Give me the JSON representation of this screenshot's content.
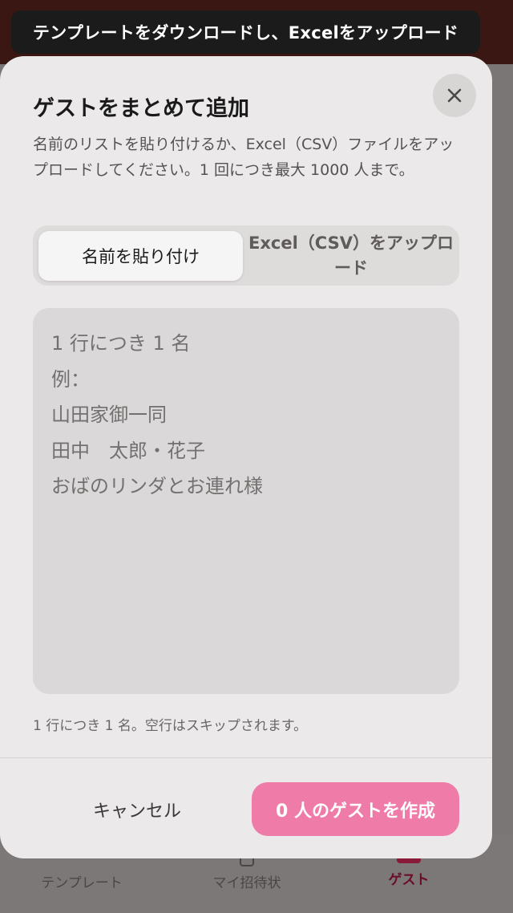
{
  "toast": {
    "text": "テンプレートをダウンロードし、Excelをアップロード"
  },
  "modal": {
    "title": "ゲストをまとめて追加",
    "description": "名前のリストを貼り付けるか、Excel（CSV）ファイルをアップロードしてください。1 回につき最大 1000 人まで。",
    "close_icon": "close-icon",
    "segments": [
      {
        "label": "名前を貼り付け",
        "selected": true
      },
      {
        "label": "Excel（CSV）をアップロード",
        "selected": false
      }
    ],
    "textarea": {
      "value": "",
      "placeholder": "1 行につき 1 名\n例：\n山田家御一同\n田中　太郎・花子\nおばのリンダとお連れ様"
    },
    "hint": "1 行につき 1 名。空行はスキップされます。",
    "cancel_label": "キャンセル",
    "create_label": "0 人のゲストを作成"
  },
  "tabbar": {
    "items": [
      {
        "label": "テンプレート",
        "icon": "grid-icon",
        "active": false
      },
      {
        "label": "マイ招待状",
        "icon": "invitation-icon",
        "active": false
      },
      {
        "label": "ゲスト",
        "icon": "guests-icon",
        "active": true
      }
    ]
  },
  "colors": {
    "accent": "#ef7ba9",
    "active_tab": "#6a0d27"
  }
}
